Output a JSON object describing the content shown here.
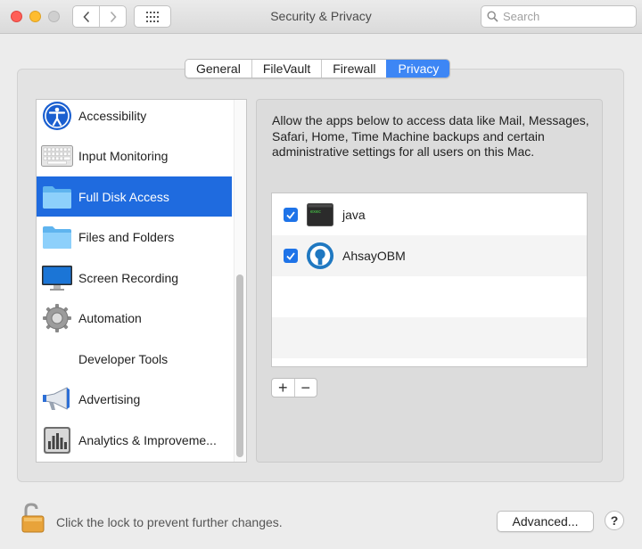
{
  "window": {
    "title": "Security & Privacy"
  },
  "search": {
    "placeholder": "Search"
  },
  "tabs": [
    {
      "label": "General",
      "active": false
    },
    {
      "label": "FileVault",
      "active": false
    },
    {
      "label": "Firewall",
      "active": false
    },
    {
      "label": "Privacy",
      "active": true
    }
  ],
  "categories": [
    {
      "label": "Accessibility",
      "icon": "accessibility-icon"
    },
    {
      "label": "Input Monitoring",
      "icon": "keyboard-icon"
    },
    {
      "label": "Full Disk Access",
      "icon": "folder-icon",
      "selected": true
    },
    {
      "label": "Files and Folders",
      "icon": "folder-icon"
    },
    {
      "label": "Screen Recording",
      "icon": "display-icon"
    },
    {
      "label": "Automation",
      "icon": "gear-icon"
    },
    {
      "label": "Developer Tools",
      "icon": ""
    },
    {
      "label": "Advertising",
      "icon": "megaphone-icon"
    },
    {
      "label": "Analytics & Improveme...",
      "icon": "analytics-icon"
    }
  ],
  "detail": {
    "description": "Allow the apps below to access data like Mail, Messages, Safari, Home, Time Machine backups and certain administrative settings for all users on this Mac.",
    "apps": [
      {
        "name": "java",
        "checked": true,
        "icon": "terminal-icon"
      },
      {
        "name": "AhsayOBM",
        "checked": true,
        "icon": "ahsay-icon"
      }
    ],
    "add_label": "+",
    "remove_label": "−"
  },
  "footer": {
    "lock_text": "Click the lock to prevent further changes.",
    "advanced_label": "Advanced...",
    "help_label": "?"
  },
  "colors": {
    "accent": "#3d86f5",
    "selection": "#1f6bdf",
    "checkbox": "#1e73e8"
  }
}
